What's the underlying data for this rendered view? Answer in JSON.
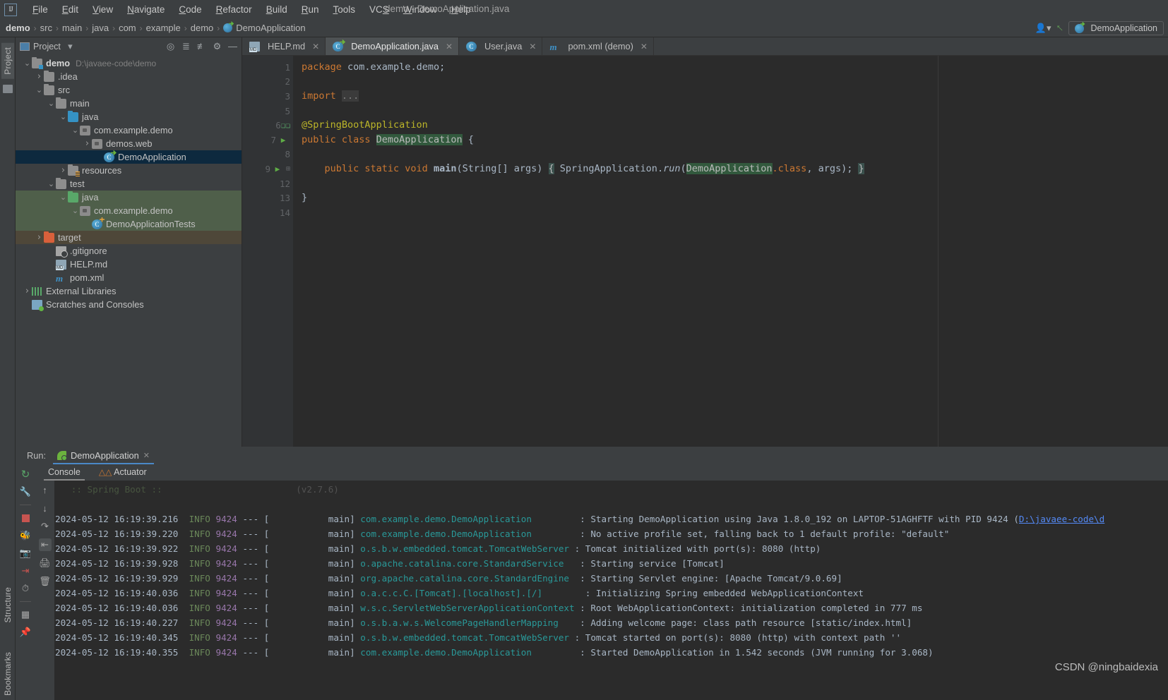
{
  "window": {
    "title": "demo - DemoApplication.java",
    "logo": "IJ"
  },
  "menu": {
    "items": [
      "File",
      "Edit",
      "View",
      "Navigate",
      "Code",
      "Refactor",
      "Build",
      "Run",
      "Tools",
      "VCS",
      "Window",
      "Help"
    ]
  },
  "breadcrumb": {
    "items": [
      "demo",
      "src",
      "main",
      "java",
      "com",
      "example",
      "demo"
    ],
    "separator": "›",
    "file": "DemoApplication"
  },
  "toolbar_right": {
    "run_config": "DemoApplication"
  },
  "left_strip": {
    "project_tab": "Project",
    "structure_tab": "Structure",
    "bookmarks_tab": "Bookmarks"
  },
  "project_panel": {
    "title": "Project",
    "tree": [
      {
        "indent": 0,
        "arrow": "⌄",
        "icon": "folder-module",
        "name": "demo",
        "bold": true,
        "path": "D:\\javaee-code\\demo",
        "state": "normal"
      },
      {
        "indent": 1,
        "arrow": "›",
        "icon": "folder",
        "name": ".idea",
        "state": "normal"
      },
      {
        "indent": 1,
        "arrow": "⌄",
        "icon": "folder",
        "name": "src",
        "state": "normal"
      },
      {
        "indent": 2,
        "arrow": "⌄",
        "icon": "folder",
        "name": "main",
        "state": "normal"
      },
      {
        "indent": 3,
        "arrow": "⌄",
        "icon": "folder-blue",
        "name": "java",
        "state": "normal"
      },
      {
        "indent": 4,
        "arrow": "⌄",
        "icon": "package",
        "name": "com.example.demo",
        "state": "normal"
      },
      {
        "indent": 5,
        "arrow": "›",
        "icon": "package",
        "name": "demos.web",
        "state": "normal"
      },
      {
        "indent": 6,
        "arrow": "",
        "icon": "class-spring",
        "name": "DemoApplication",
        "state": "selected"
      },
      {
        "indent": 3,
        "arrow": "›",
        "icon": "folder-resources",
        "name": "resources",
        "state": "normal"
      },
      {
        "indent": 2,
        "arrow": "⌄",
        "icon": "folder",
        "name": "test",
        "state": "normal"
      },
      {
        "indent": 3,
        "arrow": "⌄",
        "icon": "folder-green",
        "name": "java",
        "state": "green"
      },
      {
        "indent": 4,
        "arrow": "⌄",
        "icon": "package",
        "name": "com.example.demo",
        "state": "green"
      },
      {
        "indent": 5,
        "arrow": "",
        "icon": "class-test",
        "name": "DemoApplicationTests",
        "state": "green"
      },
      {
        "indent": 1,
        "arrow": "›",
        "icon": "folder-orange",
        "name": "target",
        "state": "brown"
      },
      {
        "indent": 2,
        "arrow": "",
        "icon": "file-git",
        "name": ".gitignore",
        "state": "normal"
      },
      {
        "indent": 2,
        "arrow": "",
        "icon": "file-md",
        "name": "HELP.md",
        "state": "normal"
      },
      {
        "indent": 2,
        "arrow": "",
        "icon": "file-maven",
        "name": "pom.xml",
        "state": "normal"
      },
      {
        "indent": 0,
        "arrow": "›",
        "icon": "libraries",
        "name": "External Libraries",
        "state": "normal"
      },
      {
        "indent": 0,
        "arrow": "",
        "icon": "scratches",
        "name": "Scratches and Consoles",
        "state": "normal"
      }
    ]
  },
  "editor": {
    "tabs": [
      {
        "label": "HELP.md",
        "icon": "markdown-icon",
        "active": false
      },
      {
        "label": "DemoApplication.java",
        "icon": "spring-class-icon",
        "active": true
      },
      {
        "label": "User.java",
        "icon": "class-icon",
        "active": false
      },
      {
        "label": "pom.xml (demo)",
        "icon": "maven-icon",
        "active": false
      }
    ],
    "line_numbers": [
      "1",
      "2",
      "3",
      "5",
      "6",
      "7",
      "8",
      "9",
      "12",
      "13",
      "14"
    ],
    "code": {
      "l1_package_kw": "package",
      "l1_package_name": " com.example.demo;",
      "l3_import_kw": "import",
      "l3_fold": "...",
      "l6_annotation": "@SpringBootApplication",
      "l7_a": "public class ",
      "l7_b": "DemoApplication",
      "l7_c": " {",
      "l9_a": "    public static void ",
      "l9_b": "main",
      "l9_c": "(String[] args) ",
      "l9_d": "{",
      "l9_e": " SpringApplication.",
      "l9_f": "run",
      "l9_g": "(",
      "l9_h": "DemoApplication",
      "l9_i": ".class",
      "l9_j": ", args); ",
      "l9_k": "}",
      "l13_close": "}"
    }
  },
  "run_window": {
    "label": "Run:",
    "tab": "DemoApplication",
    "console_tab": "Console",
    "actuator_tab": "Actuator",
    "toolbar_icons": [
      "rerun-icon",
      "wrench-icon",
      "stop-icon",
      "debug-icon",
      "camera-icon",
      "export-icon",
      "history-icon",
      "layout-icon",
      "pin-icon"
    ],
    "side_icons": [
      "scroll-up-icon",
      "scroll-down-icon",
      "soft-wrap-icon",
      "scroll-to-end-icon",
      "print-icon",
      "trash-icon"
    ],
    "console_lines": [
      {
        "partial": true,
        "banner": " :: Spring Boot ::",
        "version": "(v2.7.6)"
      },
      {
        "date": "2024-05-12 16:19:39.216",
        "level": "INFO",
        "pid": "9424",
        "dash": "--- [",
        "thread": "           main]",
        "logger": "com.example.demo.DemoApplication",
        "logger_pad": "        ",
        "msg": ": Starting DemoApplication using Java 1.8.0_192 on LAPTOP-51AGHFTF with PID 9424 (",
        "link": "D:\\javaee-code\\d"
      },
      {
        "date": "2024-05-12 16:19:39.220",
        "level": "INFO",
        "pid": "9424",
        "dash": "--- [",
        "thread": "           main]",
        "logger": "com.example.demo.DemoApplication",
        "logger_pad": "        ",
        "msg": ": No active profile set, falling back to 1 default profile: \"default\""
      },
      {
        "date": "2024-05-12 16:19:39.922",
        "level": "INFO",
        "pid": "9424",
        "dash": "--- [",
        "thread": "           main]",
        "logger": "o.s.b.w.embedded.tomcat.TomcatWebServer",
        "logger_pad": "",
        "msg": ": Tomcat initialized with port(s): 8080 (http)"
      },
      {
        "date": "2024-05-12 16:19:39.928",
        "level": "INFO",
        "pid": "9424",
        "dash": "--- [",
        "thread": "           main]",
        "logger": "o.apache.catalina.core.StandardService",
        "logger_pad": "  ",
        "msg": ": Starting service [Tomcat]"
      },
      {
        "date": "2024-05-12 16:19:39.929",
        "level": "INFO",
        "pid": "9424",
        "dash": "--- [",
        "thread": "           main]",
        "logger": "org.apache.catalina.core.StandardEngine",
        "logger_pad": " ",
        "msg": ": Starting Servlet engine: [Apache Tomcat/9.0.69]"
      },
      {
        "date": "2024-05-12 16:19:40.036",
        "level": "INFO",
        "pid": "9424",
        "dash": "--- [",
        "thread": "           main]",
        "logger": "o.a.c.c.C.[Tomcat].[localhost].[/]",
        "logger_pad": "       ",
        "msg": ": Initializing Spring embedded WebApplicationContext"
      },
      {
        "date": "2024-05-12 16:19:40.036",
        "level": "INFO",
        "pid": "9424",
        "dash": "--- [",
        "thread": "           main]",
        "logger": "w.s.c.ServletWebServerApplicationContext",
        "logger_pad": "",
        "msg": ": Root WebApplicationContext: initialization completed in 777 ms"
      },
      {
        "date": "2024-05-12 16:19:40.227",
        "level": "INFO",
        "pid": "9424",
        "dash": "--- [",
        "thread": "           main]",
        "logger": "o.s.b.a.w.s.WelcomePageHandlerMapping",
        "logger_pad": "   ",
        "msg": ": Adding welcome page: class path resource [static/index.html]"
      },
      {
        "date": "2024-05-12 16:19:40.345",
        "level": "INFO",
        "pid": "9424",
        "dash": "--- [",
        "thread": "           main]",
        "logger": "o.s.b.w.embedded.tomcat.TomcatWebServer",
        "logger_pad": "",
        "msg": ": Tomcat started on port(s): 8080 (http) with context path ''"
      },
      {
        "date": "2024-05-12 16:19:40.355",
        "level": "INFO",
        "pid": "9424",
        "dash": "--- [",
        "thread": "           main]",
        "logger": "com.example.demo.DemoApplication",
        "logger_pad": "        ",
        "msg": ": Started DemoApplication in 1.542 seconds (JVM running for 3.068)"
      }
    ]
  },
  "watermark": "CSDN @ningbaidexia",
  "colors": {
    "accent": "#4a88c7",
    "selection": "#0d293e",
    "test_green": "#4f5f4a",
    "target_brown": "#4e4739",
    "keyword": "#cc7832",
    "annotation": "#bbb529",
    "logger": "#299999",
    "info": "#6a8759",
    "pid": "#9876aa"
  }
}
